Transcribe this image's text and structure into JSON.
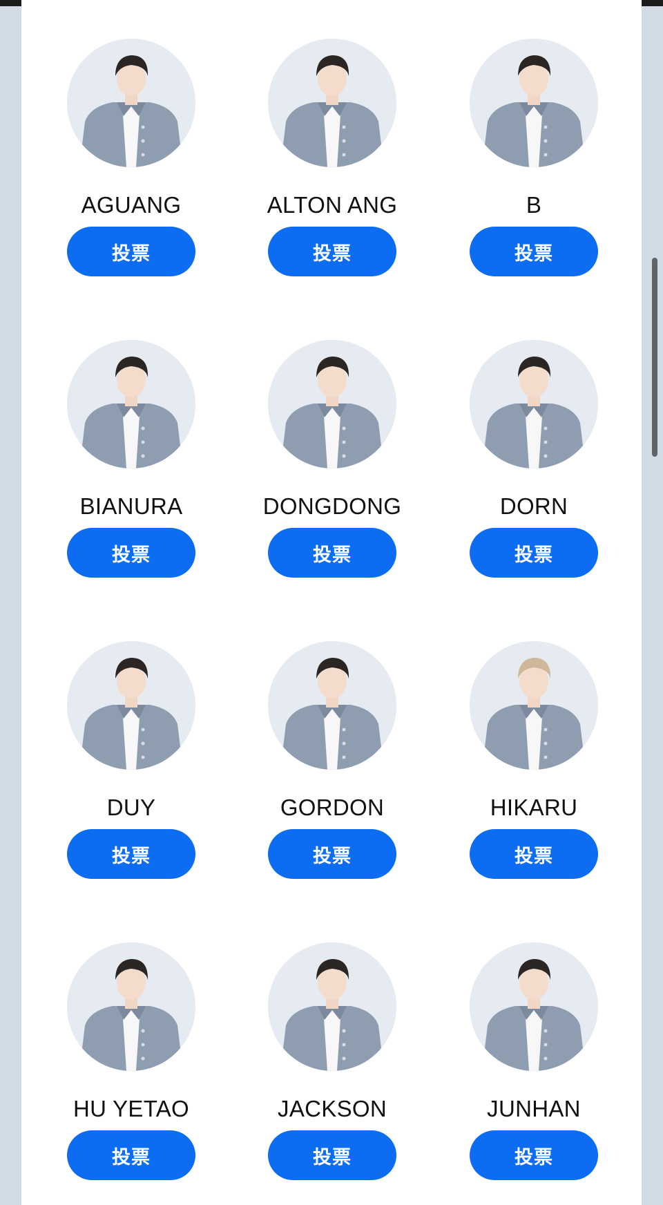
{
  "vote_label": "投票",
  "colors": {
    "accent": "#0c6cf2",
    "page_bg": "#d2dce7",
    "card_bg": "#ffffff"
  },
  "candidates": [
    {
      "name": "AGUANG"
    },
    {
      "name": "ALTON ANG"
    },
    {
      "name": "B"
    },
    {
      "name": "BIANURA"
    },
    {
      "name": "DONGDONG"
    },
    {
      "name": "DORN"
    },
    {
      "name": "DUY"
    },
    {
      "name": "GORDON"
    },
    {
      "name": "HIKARU"
    },
    {
      "name": "HU YETAO"
    },
    {
      "name": "JACKSON"
    },
    {
      "name": "JUNHAN"
    }
  ]
}
